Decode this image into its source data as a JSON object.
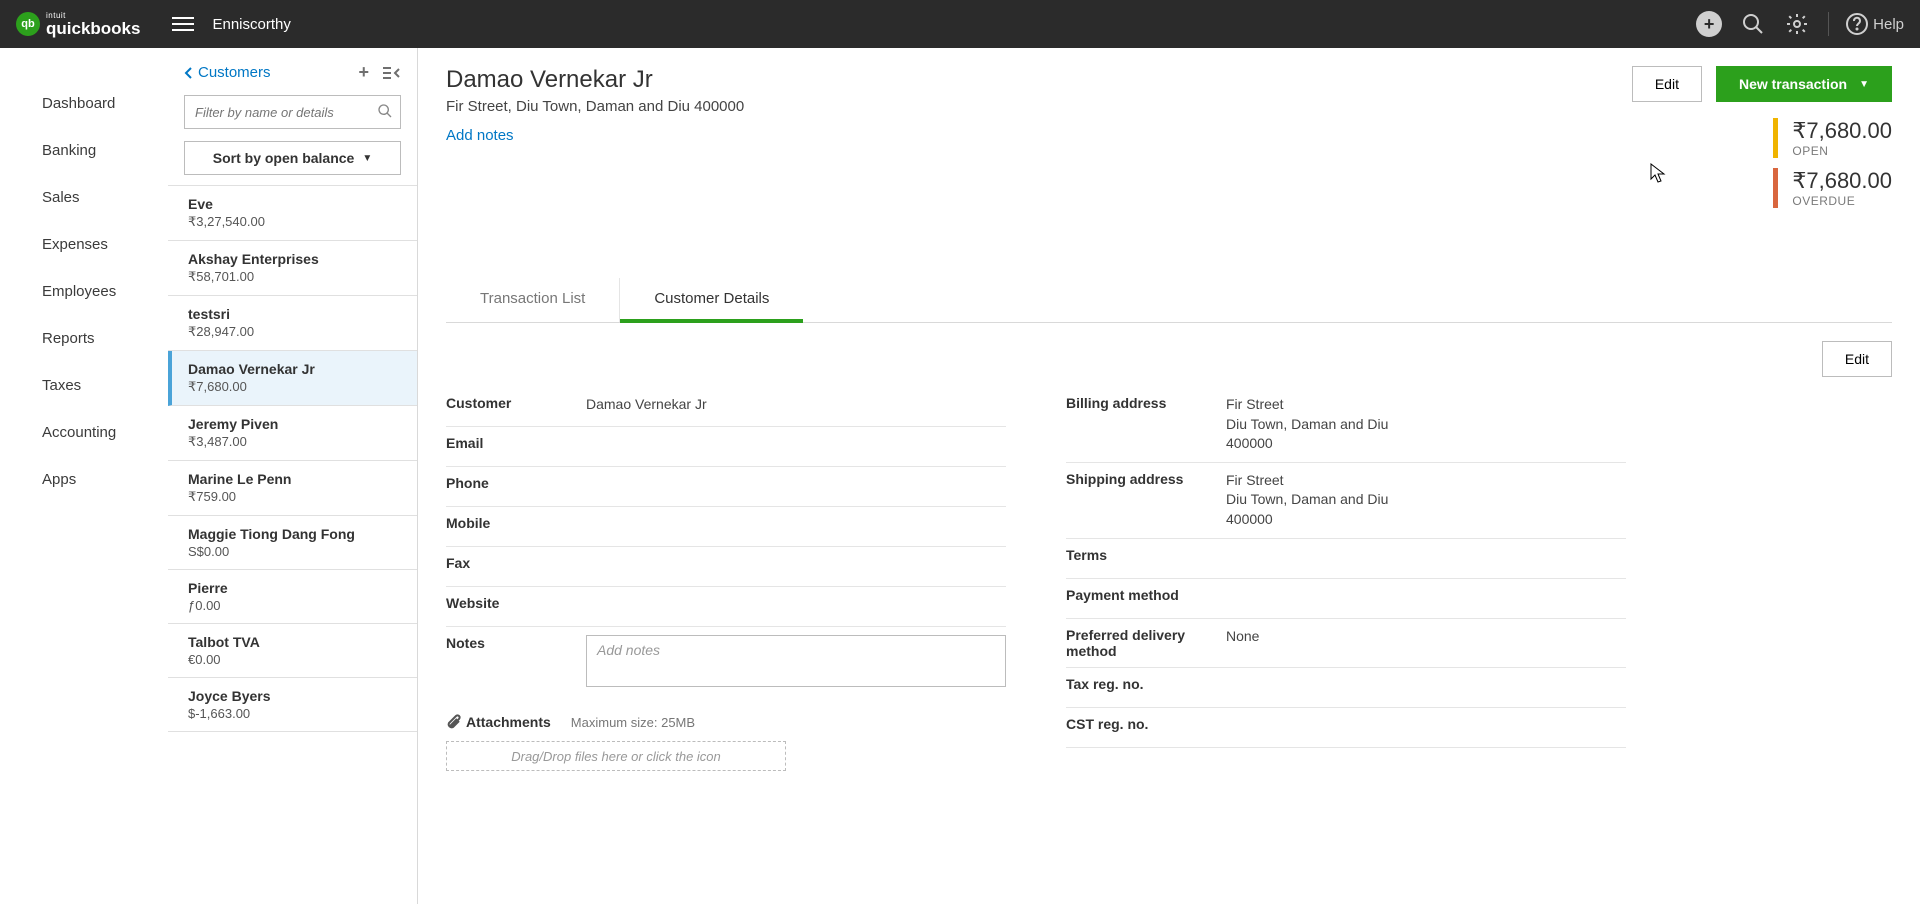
{
  "topbar": {
    "logo_sup": "intuit",
    "logo_main": "quickbooks",
    "logo_badge": "qb",
    "company": "Enniscorthy",
    "help": "Help"
  },
  "nav": {
    "items": [
      "Dashboard",
      "Banking",
      "Sales",
      "Expenses",
      "Employees",
      "Reports",
      "Taxes",
      "Accounting",
      "Apps"
    ]
  },
  "list": {
    "back_label": "Customers",
    "filter_placeholder": "Filter by name or details",
    "sort_label": "Sort by open balance",
    "customers": [
      {
        "name": "Eve",
        "balance": "₹3,27,540.00"
      },
      {
        "name": "Akshay Enterprises",
        "balance": "₹58,701.00"
      },
      {
        "name": "testsri",
        "balance": "₹28,947.00"
      },
      {
        "name": "Damao Vernekar Jr",
        "balance": "₹7,680.00"
      },
      {
        "name": "Jeremy Piven",
        "balance": "₹3,487.00"
      },
      {
        "name": "Marine Le Penn",
        "balance": "₹759.00"
      },
      {
        "name": "Maggie Tiong Dang Fong",
        "balance": "S$0.00"
      },
      {
        "name": "Pierre",
        "balance": "ƒ0.00"
      },
      {
        "name": "Talbot TVA",
        "balance": "€0.00"
      },
      {
        "name": "Joyce Byers",
        "balance": "$-1,663.00"
      }
    ]
  },
  "detail": {
    "name": "Damao Vernekar Jr",
    "address": "Fir Street, Diu Town, Daman and Diu 400000",
    "add_notes": "Add notes",
    "edit_label": "Edit",
    "new_txn_label": "New transaction",
    "open_amount": "₹7,680.00",
    "open_label": "OPEN",
    "overdue_amount": "₹7,680.00",
    "overdue_label": "OVERDUE",
    "tabs": {
      "txn": "Transaction List",
      "details": "Customer Details"
    },
    "body_edit": "Edit",
    "left_fields": {
      "customer_label": "Customer",
      "customer_value": "Damao Vernekar Jr",
      "email_label": "Email",
      "phone_label": "Phone",
      "mobile_label": "Mobile",
      "fax_label": "Fax",
      "website_label": "Website",
      "notes_label": "Notes",
      "notes_placeholder": "Add notes",
      "attachments_label": "Attachments",
      "attachments_meta": "Maximum size: 25MB",
      "dropzone_text": "Drag/Drop files here or click the icon"
    },
    "right_fields": {
      "billing_label": "Billing address",
      "billing_value_l1": "Fir Street",
      "billing_value_l2": "Diu Town, Daman and Diu",
      "billing_value_l3": "400000",
      "shipping_label": "Shipping address",
      "shipping_value_l1": "Fir Street",
      "shipping_value_l2": "Diu Town, Daman and Diu",
      "shipping_value_l3": "400000",
      "terms_label": "Terms",
      "payment_label": "Payment method",
      "delivery_label": "Preferred delivery method",
      "delivery_value": "None",
      "taxreg_label": "Tax reg. no.",
      "cstreg_label": "CST reg. no."
    }
  }
}
